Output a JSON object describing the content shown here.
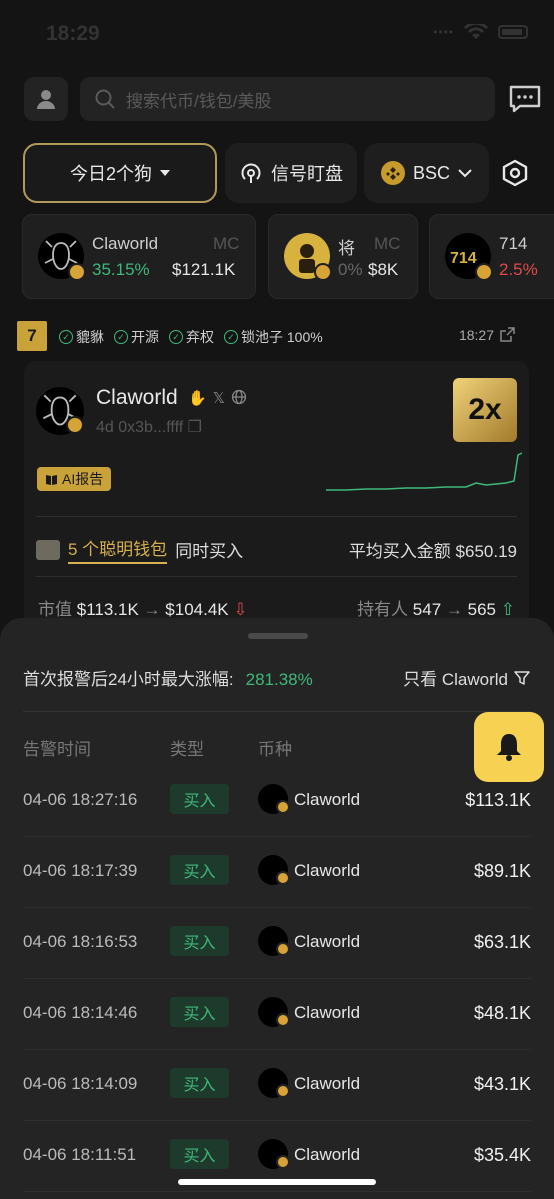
{
  "status": {
    "time": "18:29"
  },
  "search": {
    "placeholder": "搜索代币/钱包/美股"
  },
  "filters": {
    "today": "今日2个狗",
    "signal": "信号盯盘",
    "chain": "BSC"
  },
  "chips": [
    {
      "name": "Claworld",
      "mc": "MC",
      "pct": "35.15%",
      "cap": "$121.1K"
    },
    {
      "name": "将",
      "mc": "MC",
      "pct": "0%",
      "cap": "$8K"
    },
    {
      "name": "714",
      "pct": "2.5%"
    }
  ],
  "signal": {
    "num": "7",
    "tags": [
      "貔貅",
      "开源",
      "弃权",
      "锁池子 100%"
    ],
    "time": "18:27",
    "name": "Claworld",
    "sub": "4d  0x3b...ffff",
    "multiplier": "2x",
    "ai": "AI报告",
    "smart_count": "5 个聪明钱包",
    "smart_text": "同时买入",
    "avg": "平均买入金额 $650.19",
    "mcap_label": "市值",
    "mcap_from": "$113.1K",
    "mcap_to": "$104.4K",
    "holders_label": "持有人",
    "holders_from": "547",
    "holders_to": "565"
  },
  "sheet": {
    "rise_label": "首次报警后24小时最大涨幅:",
    "rise_value": "281.38%",
    "only_label": "只看 Claworld",
    "headers": [
      "告警时间",
      "类型",
      "币种"
    ],
    "rows": [
      {
        "time": "04-06 18:27:16",
        "type": "买入",
        "coin": "Claworld",
        "amt": "$113.1K"
      },
      {
        "time": "04-06 18:17:39",
        "type": "买入",
        "coin": "Claworld",
        "amt": "$89.1K"
      },
      {
        "time": "04-06 18:16:53",
        "type": "买入",
        "coin": "Claworld",
        "amt": "$63.1K"
      },
      {
        "time": "04-06 18:14:46",
        "type": "买入",
        "coin": "Claworld",
        "amt": "$48.1K"
      },
      {
        "time": "04-06 18:14:09",
        "type": "买入",
        "coin": "Claworld",
        "amt": "$43.1K"
      },
      {
        "time": "04-06 18:11:51",
        "type": "买入",
        "coin": "Claworld",
        "amt": "$35.4K"
      }
    ]
  },
  "colors": {
    "accent": "#c9a23a",
    "green": "#3fb97a",
    "red": "#e04a4a",
    "bell": "#f6d152"
  }
}
